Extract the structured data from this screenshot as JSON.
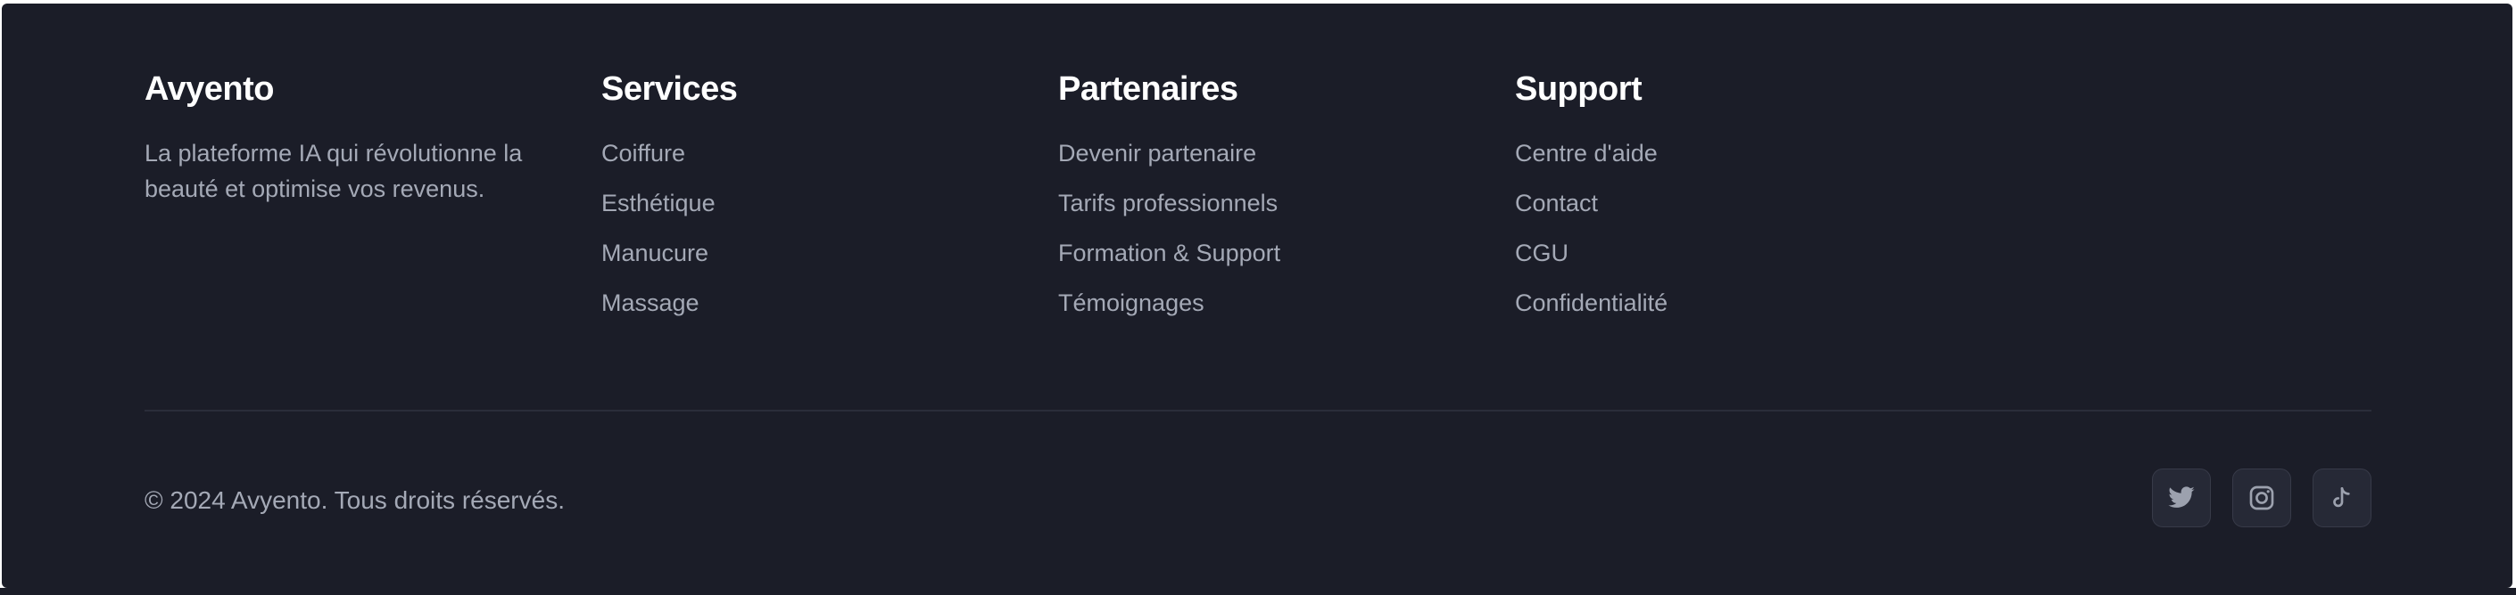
{
  "brand": {
    "name": "Avyento",
    "description": "La plateforme IA qui révolutionne la beauté et optimise vos revenus."
  },
  "services": {
    "heading": "Services",
    "links": [
      "Coiffure",
      "Esthétique",
      "Manucure",
      "Massage"
    ]
  },
  "partners": {
    "heading": "Partenaires",
    "links": [
      "Devenir partenaire",
      "Tarifs professionnels",
      "Formation & Support",
      "Témoignages"
    ]
  },
  "support": {
    "heading": "Support",
    "links": [
      "Centre d'aide",
      "Contact",
      "CGU",
      "Confidentialité"
    ]
  },
  "copyright": "© 2024 Avyento. Tous droits réservés.",
  "social": {
    "icons": [
      "twitter-icon",
      "instagram-icon",
      "tiktok-icon"
    ]
  },
  "colors": {
    "background": "#1b1d28",
    "heading": "#ffffff",
    "text": "#a4a9b6",
    "divider": "#2a2d3a",
    "social_button_bg": "#262936",
    "social_icon": "#9ca1ae"
  }
}
